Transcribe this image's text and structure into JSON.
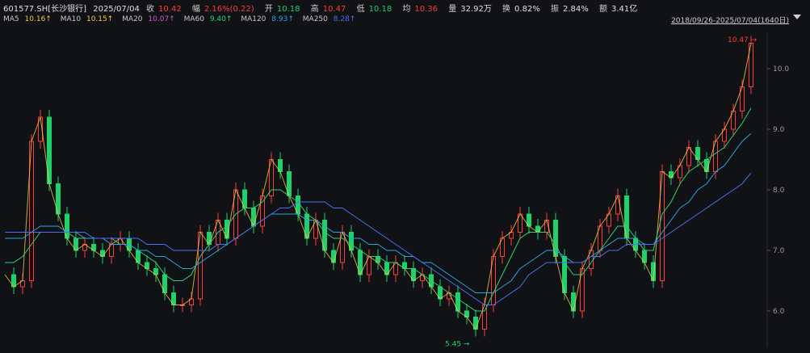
{
  "header": {
    "code": "601577.SH[长沙银行]",
    "date": "2025/07/04",
    "close_label": "收",
    "close_value": "10.42",
    "chg_label": "幅",
    "chg_value": "2.16%(0.22)",
    "open_label": "开",
    "open_value": "10.18",
    "high_label": "高",
    "high_value": "10.47",
    "low_label": "低",
    "low_value": "10.18",
    "avg_label": "均",
    "avg_value": "10.36",
    "vol_label": "量",
    "vol_value": "32.92万",
    "turnover_label": "换",
    "turnover_value": "0.82%",
    "amp_label": "振",
    "amp_value": "2.84%",
    "amount_label": "额",
    "amount_value": "3.41亿"
  },
  "ma_legend": [
    {
      "label": "MA5",
      "value": "10.16↑",
      "color": "#ffffff"
    },
    {
      "label": "MA10",
      "value": "10.15↑",
      "color": "#f2c94c"
    },
    {
      "label": "MA20",
      "value": "10.07↑",
      "color": "#d45bd6"
    },
    {
      "label": "MA60",
      "value": "9.40↑",
      "color": "#2fd36f"
    },
    {
      "label": "MA120",
      "value": "8.93↑",
      "color": "#2aa6d8"
    },
    {
      "label": "MA250",
      "value": "8.28↑",
      "color": "#4a6ff0"
    }
  ],
  "range_label": "2018/09/26-2025/07/04(1640日)",
  "colors": {
    "up": "#ff3b3b",
    "down": "#1fd06b",
    "ma60": "#2fd36f",
    "ma120": "#2aa6d8",
    "ma250": "#4a6ff0"
  },
  "chart_data": {
    "type": "line",
    "ylim": [
      5.4,
      10.6
    ],
    "yticks": [
      6.0,
      7.0,
      8.0,
      9.0,
      10.0
    ],
    "ytick_labels": [
      "6.0",
      "7.0",
      "8.0",
      "9.0",
      "10.0"
    ],
    "high_mark": "10.47",
    "low_mark": "5.45",
    "series": [
      {
        "values": [
          6.6,
          6.4,
          6.5,
          8.8,
          9.2,
          8.1,
          7.6,
          7.2,
          7.0,
          7.1,
          7.0,
          6.9,
          7.1,
          7.2,
          7.0,
          6.8,
          6.7,
          6.6,
          6.3,
          6.1,
          6.1,
          6.2,
          7.3,
          7.1,
          7.5,
          7.2,
          8.0,
          7.7,
          7.4,
          7.9,
          8.5,
          8.3,
          7.9,
          7.6,
          7.2,
          7.5,
          7.0,
          6.8,
          7.3,
          7.0,
          6.6,
          6.9,
          6.8,
          6.6,
          6.8,
          6.7,
          6.5,
          6.6,
          6.4,
          6.2,
          6.3,
          6.0,
          5.9,
          5.7,
          6.1,
          6.9,
          7.2,
          7.3,
          7.6,
          7.4,
          7.3,
          7.5,
          6.9,
          6.3,
          6.0,
          6.7,
          7.0,
          7.4,
          7.6,
          7.9,
          7.2,
          7.0,
          6.8,
          6.5,
          8.3,
          8.2,
          8.4,
          8.7,
          8.5,
          8.3,
          8.8,
          9.0,
          9.3,
          9.7,
          10.42
        ]
      },
      {
        "values": [
          6.8,
          6.8,
          6.9,
          7.1,
          7.3,
          7.3,
          7.3,
          7.3,
          7.2,
          7.2,
          7.2,
          7.2,
          7.2,
          7.1,
          7.1,
          7.0,
          6.9,
          6.8,
          6.6,
          6.5,
          6.5,
          6.6,
          6.9,
          7.1,
          7.3,
          7.4,
          7.6,
          7.7,
          7.7,
          7.8,
          8.0,
          8.0,
          7.9,
          7.8,
          7.6,
          7.5,
          7.3,
          7.2,
          7.2,
          7.1,
          7.0,
          6.9,
          6.9,
          6.8,
          6.8,
          6.7,
          6.7,
          6.6,
          6.5,
          6.4,
          6.3,
          6.2,
          6.1,
          6.0,
          6.0,
          6.3,
          6.6,
          6.9,
          7.2,
          7.3,
          7.3,
          7.3,
          7.1,
          6.8,
          6.6,
          6.6,
          6.8,
          7.0,
          7.2,
          7.4,
          7.4,
          7.2,
          7.0,
          7.0,
          7.6,
          7.8,
          8.1,
          8.3,
          8.4,
          8.5,
          8.6,
          8.7,
          8.9,
          9.1,
          9.35
        ]
      },
      {
        "values": [
          7.2,
          7.2,
          7.2,
          7.3,
          7.4,
          7.4,
          7.4,
          7.3,
          7.3,
          7.2,
          7.2,
          7.2,
          7.1,
          7.1,
          7.1,
          7.0,
          7.0,
          6.9,
          6.9,
          6.8,
          6.7,
          6.7,
          6.8,
          6.9,
          7.0,
          7.1,
          7.2,
          7.3,
          7.4,
          7.5,
          7.6,
          7.6,
          7.6,
          7.6,
          7.5,
          7.5,
          7.4,
          7.3,
          7.3,
          7.2,
          7.2,
          7.1,
          7.1,
          7.0,
          7.0,
          6.9,
          6.9,
          6.8,
          6.8,
          6.7,
          6.6,
          6.5,
          6.4,
          6.3,
          6.3,
          6.3,
          6.4,
          6.5,
          6.7,
          6.8,
          6.9,
          7.0,
          7.0,
          6.9,
          6.8,
          6.8,
          6.9,
          7.0,
          7.1,
          7.2,
          7.2,
          7.2,
          7.1,
          7.1,
          7.3,
          7.5,
          7.7,
          7.8,
          8.0,
          8.1,
          8.3,
          8.4,
          8.6,
          8.8,
          8.93
        ]
      },
      {
        "values": [
          7.3,
          7.3,
          7.3,
          7.3,
          7.3,
          7.3,
          7.3,
          7.3,
          7.3,
          7.3,
          7.2,
          7.2,
          7.2,
          7.2,
          7.2,
          7.2,
          7.1,
          7.1,
          7.1,
          7.0,
          7.0,
          7.0,
          7.0,
          7.0,
          7.1,
          7.1,
          7.2,
          7.3,
          7.4,
          7.5,
          7.6,
          7.7,
          7.7,
          7.8,
          7.8,
          7.8,
          7.8,
          7.7,
          7.7,
          7.6,
          7.5,
          7.4,
          7.3,
          7.2,
          7.1,
          7.0,
          6.9,
          6.8,
          6.7,
          6.6,
          6.5,
          6.4,
          6.3,
          6.2,
          6.1,
          6.1,
          6.2,
          6.3,
          6.4,
          6.6,
          6.7,
          6.8,
          6.8,
          6.8,
          6.8,
          6.8,
          6.9,
          6.9,
          7.0,
          7.0,
          7.1,
          7.1,
          7.1,
          7.1,
          7.2,
          7.3,
          7.4,
          7.5,
          7.6,
          7.7,
          7.8,
          7.9,
          8.0,
          8.1,
          8.28
        ]
      }
    ]
  }
}
